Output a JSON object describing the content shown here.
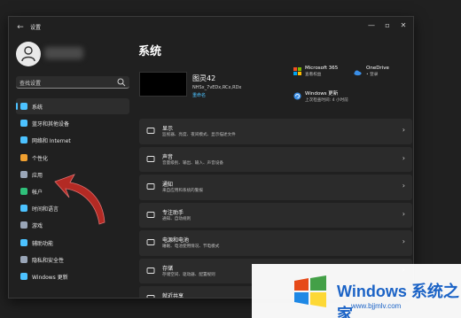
{
  "window": {
    "title": "设置"
  },
  "search": {
    "placeholder": "查找设置"
  },
  "nav": [
    {
      "label": "系统",
      "icon": "monitor-icon",
      "color": "#4cc2ff",
      "active": true
    },
    {
      "label": "蓝牙和其他设备",
      "icon": "bluetooth-icon",
      "color": "#4cc2ff"
    },
    {
      "label": "网络和 Internet",
      "icon": "wifi-icon",
      "color": "#4cc2ff"
    },
    {
      "label": "个性化",
      "icon": "brush-icon",
      "color": "#f0a030"
    },
    {
      "label": "应用",
      "icon": "apps-icon",
      "color": "#9aa6b8"
    },
    {
      "label": "帐户",
      "icon": "person-icon",
      "color": "#2fc07a"
    },
    {
      "label": "时间和语言",
      "icon": "globe-clock-icon",
      "color": "#4cc2ff"
    },
    {
      "label": "游戏",
      "icon": "gamepad-icon",
      "color": "#9aa6b8"
    },
    {
      "label": "辅助功能",
      "icon": "accessibility-icon",
      "color": "#4cc2ff"
    },
    {
      "label": "隐私和安全性",
      "icon": "shield-icon",
      "color": "#9aa6b8"
    },
    {
      "label": "Windows 更新",
      "icon": "update-icon",
      "color": "#4cc2ff"
    }
  ],
  "main": {
    "title": "系统",
    "device": {
      "name": "图灵42",
      "model": "NHSx_7vEDx,RCx,RDx",
      "rename": "重命名"
    },
    "services": [
      {
        "name": "Microsoft 365",
        "sub": "查看权益",
        "icon": "microsoft-365-icon"
      },
      {
        "name": "OneDrive",
        "sub": "• 登录",
        "icon": "onedrive-icon"
      },
      {
        "name": "Windows 更新",
        "sub": "上次检查时间: 4 小时前",
        "icon": "windows-update-icon"
      }
    ],
    "rows": [
      {
        "title": "显示",
        "sub": "监视器、亮度、夜间模式、显示描述文件",
        "icon": "display-icon"
      },
      {
        "title": "声音",
        "sub": "音量级别、输出、输入、声音设备",
        "icon": "speaker-icon"
      },
      {
        "title": "通知",
        "sub": "来自应用和系统的警报",
        "icon": "bell-icon"
      },
      {
        "title": "专注助手",
        "sub": "通知、自动规则",
        "icon": "moon-icon"
      },
      {
        "title": "电源和电池",
        "sub": "睡眠、电池使用情况、节电模式",
        "icon": "power-icon"
      },
      {
        "title": "存储",
        "sub": "存储空间、驱动器、配置规则",
        "icon": "storage-icon"
      },
      {
        "title": "就近共享",
        "sub": "",
        "icon": "share-icon"
      }
    ]
  },
  "watermark": {
    "title": "Windows 系统之家",
    "url": "www.bjjmlv.com"
  }
}
